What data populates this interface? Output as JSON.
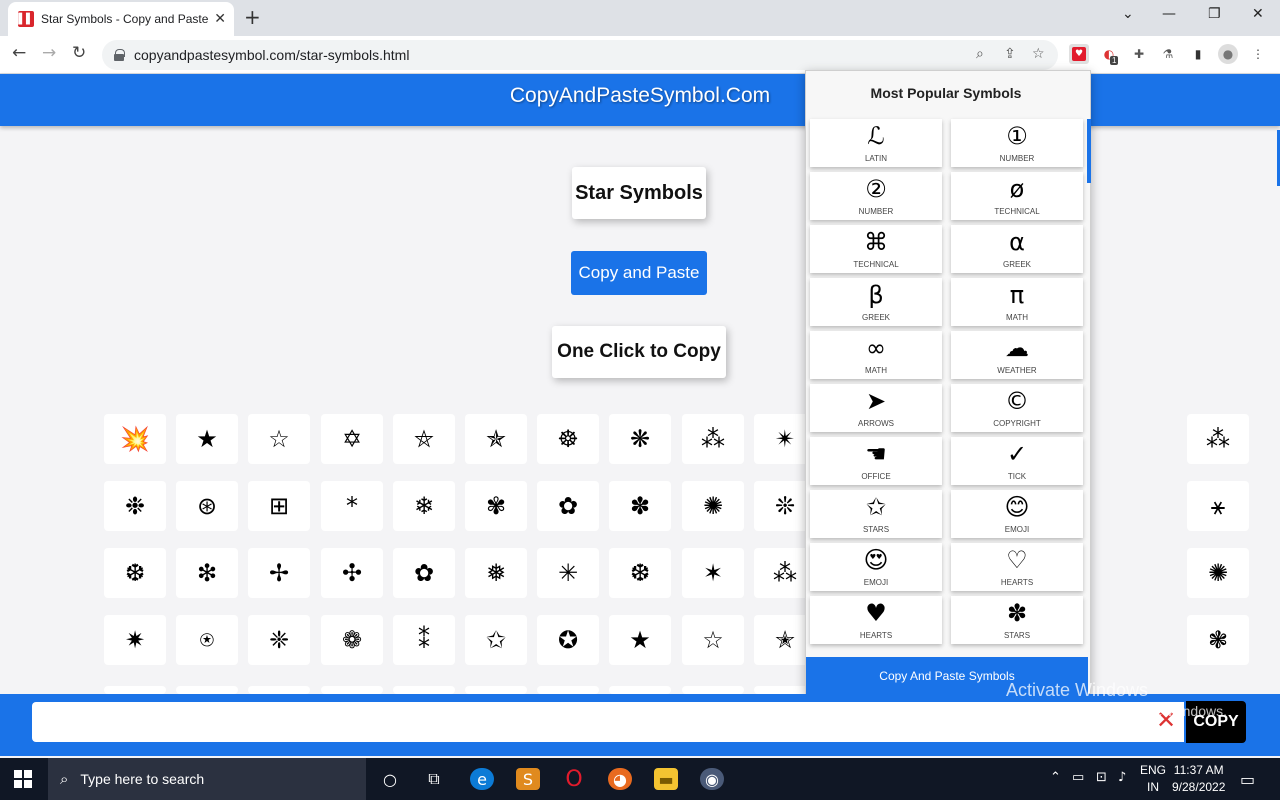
{
  "browser": {
    "tab_title": "Star Symbols - Copy and Paste -",
    "url": "copyandpastesymbol.com/star-symbols.html",
    "ext_badge": "1"
  },
  "page": {
    "site_title": "CopyAndPasteSymbol.Com",
    "heading": "Star Symbols",
    "copy_paste_label": "Copy and Paste",
    "one_click_label": "One Click to Copy",
    "grid_rows": [
      [
        "💥",
        "★",
        "☆",
        "✡",
        "⛤",
        "✯",
        "☸",
        "❋",
        "⁂",
        "✴",
        "",
        "",
        "",
        "",
        "",
        "⁂"
      ],
      [
        "❉",
        "⊛",
        "⊞",
        "*",
        "❄",
        "✾",
        "✿",
        "✽",
        "✺",
        "❊",
        "",
        "",
        "",
        "",
        "",
        "⚹"
      ],
      [
        "❆",
        "❇",
        "✢",
        "✣",
        "✿",
        "❅",
        "✳",
        "❆",
        "✶",
        "⁂",
        "",
        "",
        "",
        "",
        "",
        "✺"
      ],
      [
        "✷",
        "⍟",
        "❈",
        "❁",
        "⁑",
        "✩",
        "✪",
        "★",
        "☆",
        "✭",
        "",
        "",
        "",
        "",
        "",
        "❃"
      ]
    ]
  },
  "popup": {
    "title": "Most Popular Symbols",
    "items": [
      {
        "symbol": "ℒ",
        "category": "LATIN"
      },
      {
        "symbol": "①",
        "category": "NUMBER"
      },
      {
        "symbol": "②",
        "category": "NUMBER"
      },
      {
        "symbol": "ø",
        "category": "TECHNICAL"
      },
      {
        "symbol": "⌘",
        "category": "TECHNICAL"
      },
      {
        "symbol": "α",
        "category": "GREEK"
      },
      {
        "symbol": "β",
        "category": "GREEK"
      },
      {
        "symbol": "π",
        "category": "MATH"
      },
      {
        "symbol": "∞",
        "category": "MATH"
      },
      {
        "symbol": "☁",
        "category": "WEATHER"
      },
      {
        "symbol": "➤",
        "category": "ARROWS"
      },
      {
        "symbol": "©",
        "category": "COPYRIGHT"
      },
      {
        "symbol": "☚",
        "category": "OFFICE"
      },
      {
        "symbol": "✓",
        "category": "TICK"
      },
      {
        "symbol": "✩",
        "category": "STARS"
      },
      {
        "symbol": "😊",
        "category": "EMOJI"
      },
      {
        "symbol": "😍",
        "category": "EMOJI"
      },
      {
        "symbol": "♡",
        "category": "HEARTS"
      },
      {
        "symbol": "♥",
        "category": "HEARTS"
      },
      {
        "symbol": "✽",
        "category": "STARS"
      }
    ],
    "footer": "Copy And Paste Symbols"
  },
  "copybar": {
    "input_value": "",
    "clear_glyph": "✕",
    "copy_label": "COPY"
  },
  "windows_watermark": {
    "line1": "Activate Windows",
    "line2": "Go to Settings to activate Windows."
  },
  "taskbar": {
    "search_placeholder": "Type here to search",
    "lang_line1": "ENG",
    "lang_line2": "IN",
    "time": "11:37 AM",
    "date": "9/28/2022"
  },
  "colors": {
    "brand_blue": "#1a73e8",
    "taskbar": "#101725"
  }
}
